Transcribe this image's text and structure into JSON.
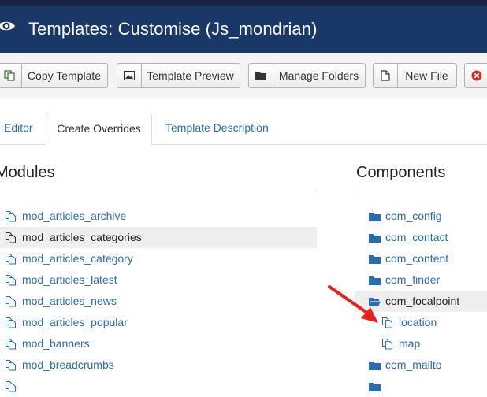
{
  "header": {
    "title": "Templates: Customise (Js_mondrian)",
    "icon": "eye-icon"
  },
  "toolbar": {
    "copy_template": "Copy Template",
    "template_preview": "Template Preview",
    "manage_folders": "Manage Folders",
    "new_file": "New File"
  },
  "tabs": {
    "editor": "Editor",
    "create_overrides": "Create Overrides",
    "template_description": "Template Description"
  },
  "modules": {
    "title": "Modules",
    "items": [
      "mod_articles_archive",
      "mod_articles_categories",
      "mod_articles_category",
      "mod_articles_latest",
      "mod_articles_news",
      "mod_articles_popular",
      "mod_banners",
      "mod_breadcrumbs"
    ],
    "highlighted": "mod_articles_categories"
  },
  "components": {
    "title": "Components",
    "items": [
      "com_config",
      "com_contact",
      "com_content",
      "com_finder",
      "com_focalpoint",
      "location",
      "map",
      "com_mailto"
    ],
    "highlighted": "com_focalpoint"
  },
  "colors": {
    "header_bg": "#1a3867",
    "link": "#2a6cb0",
    "annotation_arrow": "#e8201a"
  }
}
